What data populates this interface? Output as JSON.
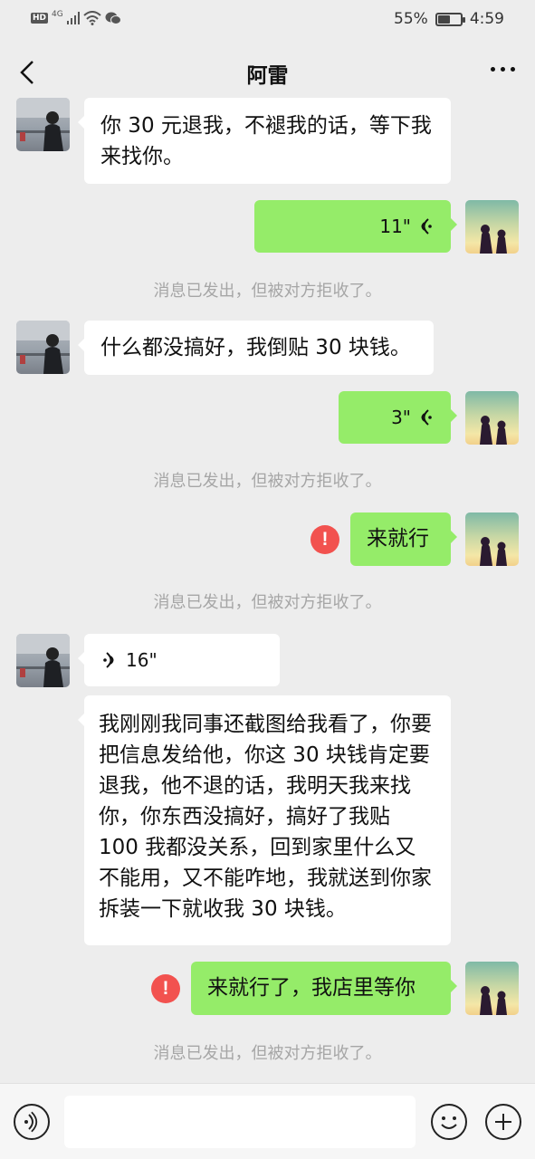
{
  "status_bar": {
    "hd_label": "HD",
    "network_label": "4G",
    "battery_percent": "55%",
    "battery_level": 0.55,
    "time": "4:59"
  },
  "header": {
    "title": "阿雷"
  },
  "messages": [
    {
      "sender": "other",
      "type": "text",
      "text": "你 30 元退我，不褪我的话，等下我来找你。"
    },
    {
      "sender": "self",
      "type": "voice",
      "duration": "11\""
    },
    {
      "sender": "system",
      "type": "notice",
      "text": "消息已发出，但被对方拒收了。"
    },
    {
      "sender": "other",
      "type": "text",
      "text": "什么都没搞好，我倒贴 30 块钱。"
    },
    {
      "sender": "self",
      "type": "voice",
      "duration": "3\""
    },
    {
      "sender": "system",
      "type": "notice",
      "text": "消息已发出，但被对方拒收了。"
    },
    {
      "sender": "self",
      "type": "text",
      "text": "来就行",
      "error": "!"
    },
    {
      "sender": "system",
      "type": "notice",
      "text": "消息已发出，但被对方拒收了。"
    },
    {
      "sender": "other",
      "type": "voice",
      "duration": "16\""
    },
    {
      "sender": "other",
      "type": "text",
      "text": "我刚刚我同事还截图给我看了，你要把信息发给他，你这 30 块钱肯定要退我，他不退的话，我明天我来找你，你东西没搞好，搞好了我贴 100 我都没关系，回到家里什么又不能用，又不能咋地，我就送到你家拆装一下就收我 30 块钱。"
    },
    {
      "sender": "self",
      "type": "text",
      "text": "来就行了，我店里等你",
      "error": "!"
    },
    {
      "sender": "system",
      "type": "notice",
      "text": "消息已发出，但被对方拒收了。"
    }
  ],
  "icons": {
    "back": "chevron-left-icon",
    "more": "more-dots-icon",
    "voice_toggle": "voice-icon",
    "emoji": "emoji-icon",
    "plus": "plus-icon",
    "error": "error-icon"
  },
  "colors": {
    "background": "#ededed",
    "self_bubble": "#95ec69",
    "other_bubble": "#ffffff",
    "error": "#f2524f",
    "notice_text": "#a6a6a6"
  },
  "input": {
    "placeholder": ""
  }
}
